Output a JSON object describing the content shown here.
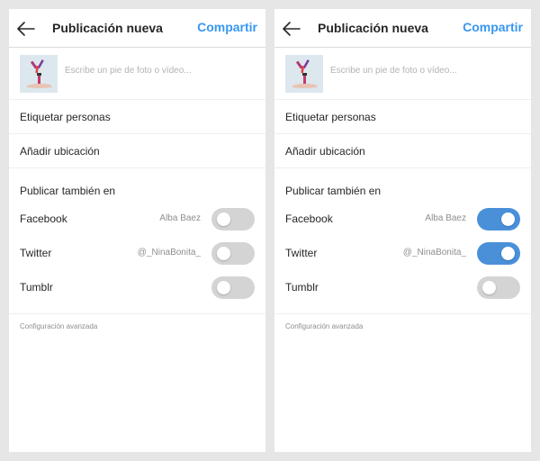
{
  "screens": [
    {
      "header": {
        "title": "Publicación nueva",
        "share_label": "Compartir"
      },
      "caption": {
        "placeholder": "Escribe un pie de foto o vídeo...",
        "value": ""
      },
      "options": {
        "tag_people": "Etiquetar personas",
        "add_location": "Añadir ubicación"
      },
      "share_also": {
        "title": "Publicar también en",
        "networks": [
          {
            "name": "Facebook",
            "account": "Alba Baez",
            "enabled": false
          },
          {
            "name": "Twitter",
            "account": "@_NinaBonita_",
            "enabled": false
          },
          {
            "name": "Tumblr",
            "account": "",
            "enabled": false
          }
        ]
      },
      "advanced_settings": "Configuración avanzada"
    },
    {
      "header": {
        "title": "Publicación nueva",
        "share_label": "Compartir"
      },
      "caption": {
        "placeholder": "Escribe un pie de foto o vídeo...",
        "value": ""
      },
      "options": {
        "tag_people": "Etiquetar personas",
        "add_location": "Añadir ubicación"
      },
      "share_also": {
        "title": "Publicar también en",
        "networks": [
          {
            "name": "Facebook",
            "account": "Alba Baez",
            "enabled": true
          },
          {
            "name": "Twitter",
            "account": "@_NinaBonita_",
            "enabled": true
          },
          {
            "name": "Tumblr",
            "account": "",
            "enabled": false
          }
        ]
      },
      "advanced_settings": "Configuración avanzada"
    }
  ],
  "colors": {
    "accent": "#3897f0",
    "toggle_on": "#4a90d9",
    "toggle_off": "#d4d4d4",
    "background": "#e6e6e6"
  }
}
